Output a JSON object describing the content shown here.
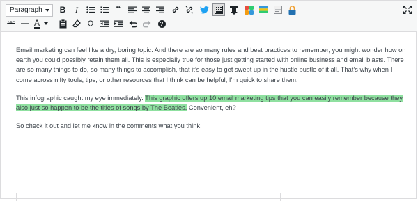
{
  "toolbar": {
    "format_select": "Paragraph",
    "bold_label": "B",
    "italic_label": "I",
    "strike_label": "ABC",
    "text_color_label": "A",
    "special_char_label": "Ω",
    "help_label": "?"
  },
  "colors": {
    "highlight": "#8fe0a0",
    "twitter": "#1da1f2"
  },
  "content": {
    "paragraph1": "Email marketing can feel like a dry, boring topic. And there are so many rules and best practices to remember, you might wonder how on earth you could possibly retain them all. This is especially true for those just getting started with online business and email blasts. There are so many things to do, so many things to accomplish, that it’s easy to get swept up in the hustle bustle of it all. That’s why when I come across nifty tools, tips, or other resources that I think can be helpful, I’m quick to share them.",
    "paragraph2_before": "This infographic caught my eye immediately. ",
    "paragraph2_highlight": "This graphic offers up 10 email marketing tips that you can easily remember because they also just so happen to be the titles of songs by The Beatles.",
    "paragraph2_after": " Convenient, eh?",
    "paragraph3": "So check it out and let me know in the comments what you think."
  }
}
